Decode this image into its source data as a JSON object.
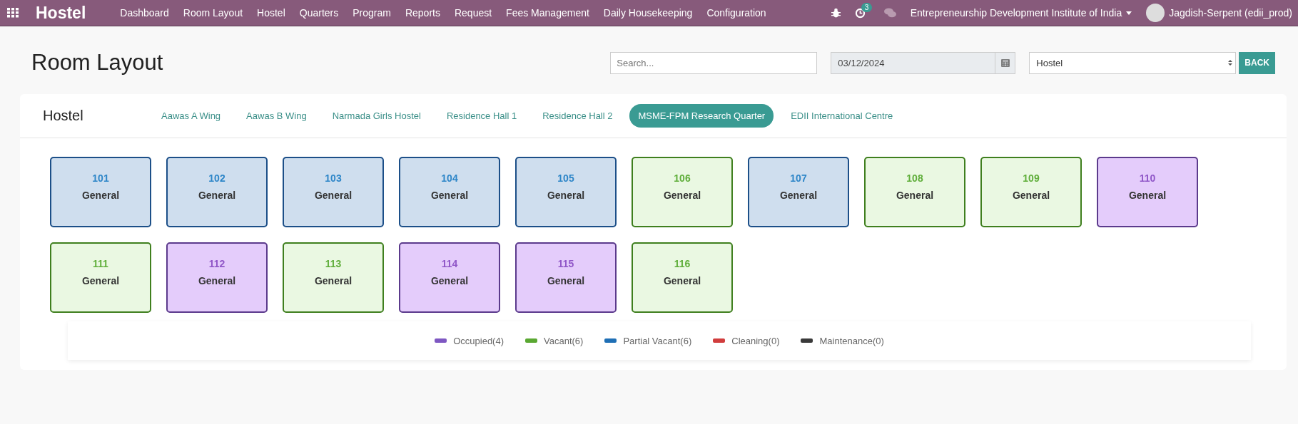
{
  "navbar": {
    "app_title": "Hostel",
    "menu": [
      "Dashboard",
      "Room Layout",
      "Hostel",
      "Quarters",
      "Program",
      "Reports",
      "Request",
      "Fees Management",
      "Daily Housekeeping",
      "Configuration"
    ],
    "activity_count": "3",
    "company": "Entrepreneurship Development Institute of India",
    "user": "Jagdish-Serpent (edii_prod)"
  },
  "page": {
    "title": "Room Layout",
    "search": {
      "placeholder": "Search..."
    },
    "date": "03/12/2024",
    "select": "Hostel",
    "back": "BACK"
  },
  "panel": {
    "title": "Hostel",
    "tabs": [
      {
        "label": "Aawas A Wing",
        "selected": false
      },
      {
        "label": "Aawas B Wing",
        "selected": false
      },
      {
        "label": "Narmada Girls Hostel",
        "selected": false
      },
      {
        "label": "Residence Hall 1",
        "selected": false
      },
      {
        "label": "Residence Hall 2",
        "selected": false
      },
      {
        "label": "MSME-FPM Research Quarter",
        "selected": true
      },
      {
        "label": "EDII International Centre",
        "selected": false
      }
    ],
    "rooms": [
      {
        "number": "101",
        "type": "General",
        "kind": "partial"
      },
      {
        "number": "102",
        "type": "General",
        "kind": "partial"
      },
      {
        "number": "103",
        "type": "General",
        "kind": "partial"
      },
      {
        "number": "104",
        "type": "General",
        "kind": "partial"
      },
      {
        "number": "105",
        "type": "General",
        "kind": "partial"
      },
      {
        "number": "106",
        "type": "General",
        "kind": "vacant"
      },
      {
        "number": "107",
        "type": "General",
        "kind": "partial"
      },
      {
        "number": "108",
        "type": "General",
        "kind": "vacant"
      },
      {
        "number": "109",
        "type": "General",
        "kind": "vacant"
      },
      {
        "number": "110",
        "type": "General",
        "kind": "occupied"
      },
      {
        "number": "111",
        "type": "General",
        "kind": "vacant"
      },
      {
        "number": "112",
        "type": "General",
        "kind": "occupied"
      },
      {
        "number": "113",
        "type": "General",
        "kind": "vacant"
      },
      {
        "number": "114",
        "type": "General",
        "kind": "occupied"
      },
      {
        "number": "115",
        "type": "General",
        "kind": "occupied"
      },
      {
        "number": "116",
        "type": "General",
        "kind": "vacant"
      }
    ],
    "legend": [
      {
        "label": "Occupied(4)",
        "color": "#7e57c2"
      },
      {
        "label": "Vacant(6)",
        "color": "#5aa832"
      },
      {
        "label": "Partial Vacant(6)",
        "color": "#1f6fb5"
      },
      {
        "label": "Cleaning(0)",
        "color": "#d13d3d"
      },
      {
        "label": "Maintenance(0)",
        "color": "#3a3a3a"
      }
    ]
  }
}
